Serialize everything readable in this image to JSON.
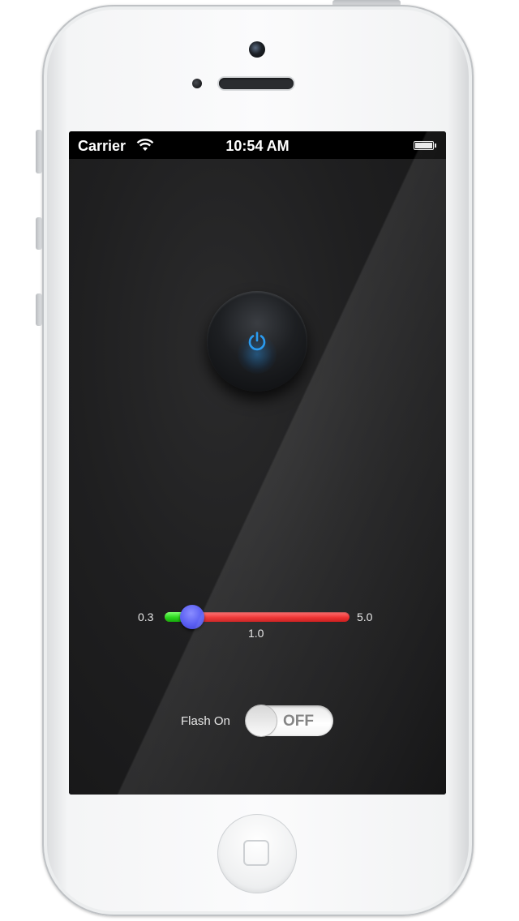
{
  "status_bar": {
    "carrier": "Carrier",
    "time": "10:54 AM",
    "wifi_icon": "wifi-icon",
    "battery_icon": "battery-icon"
  },
  "power": {
    "icon": "power-icon",
    "accent_color": "#2a9bf0"
  },
  "slider": {
    "min_label": "0.3",
    "max_label": "5.0",
    "value_label": "1.0",
    "min": 0.3,
    "max": 5.0,
    "value": 1.0,
    "fill_color": "#2bd61e",
    "track_color": "#ee2a2a",
    "thumb_color": "#5a5ef2"
  },
  "flash": {
    "label": "Flash On",
    "state_label": "OFF",
    "on": false
  }
}
